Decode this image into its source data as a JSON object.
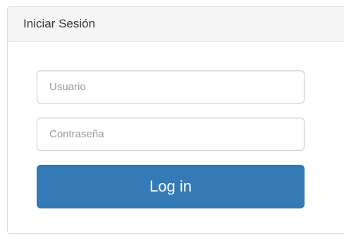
{
  "panel": {
    "title": "Iniciar Sesión"
  },
  "form": {
    "username": {
      "placeholder": "Usuario",
      "value": ""
    },
    "password": {
      "placeholder": "Contraseña",
      "value": ""
    },
    "submit_label": "Log in"
  },
  "colors": {
    "primary_button": "#337ab7",
    "heading_background": "#f5f5f5"
  }
}
